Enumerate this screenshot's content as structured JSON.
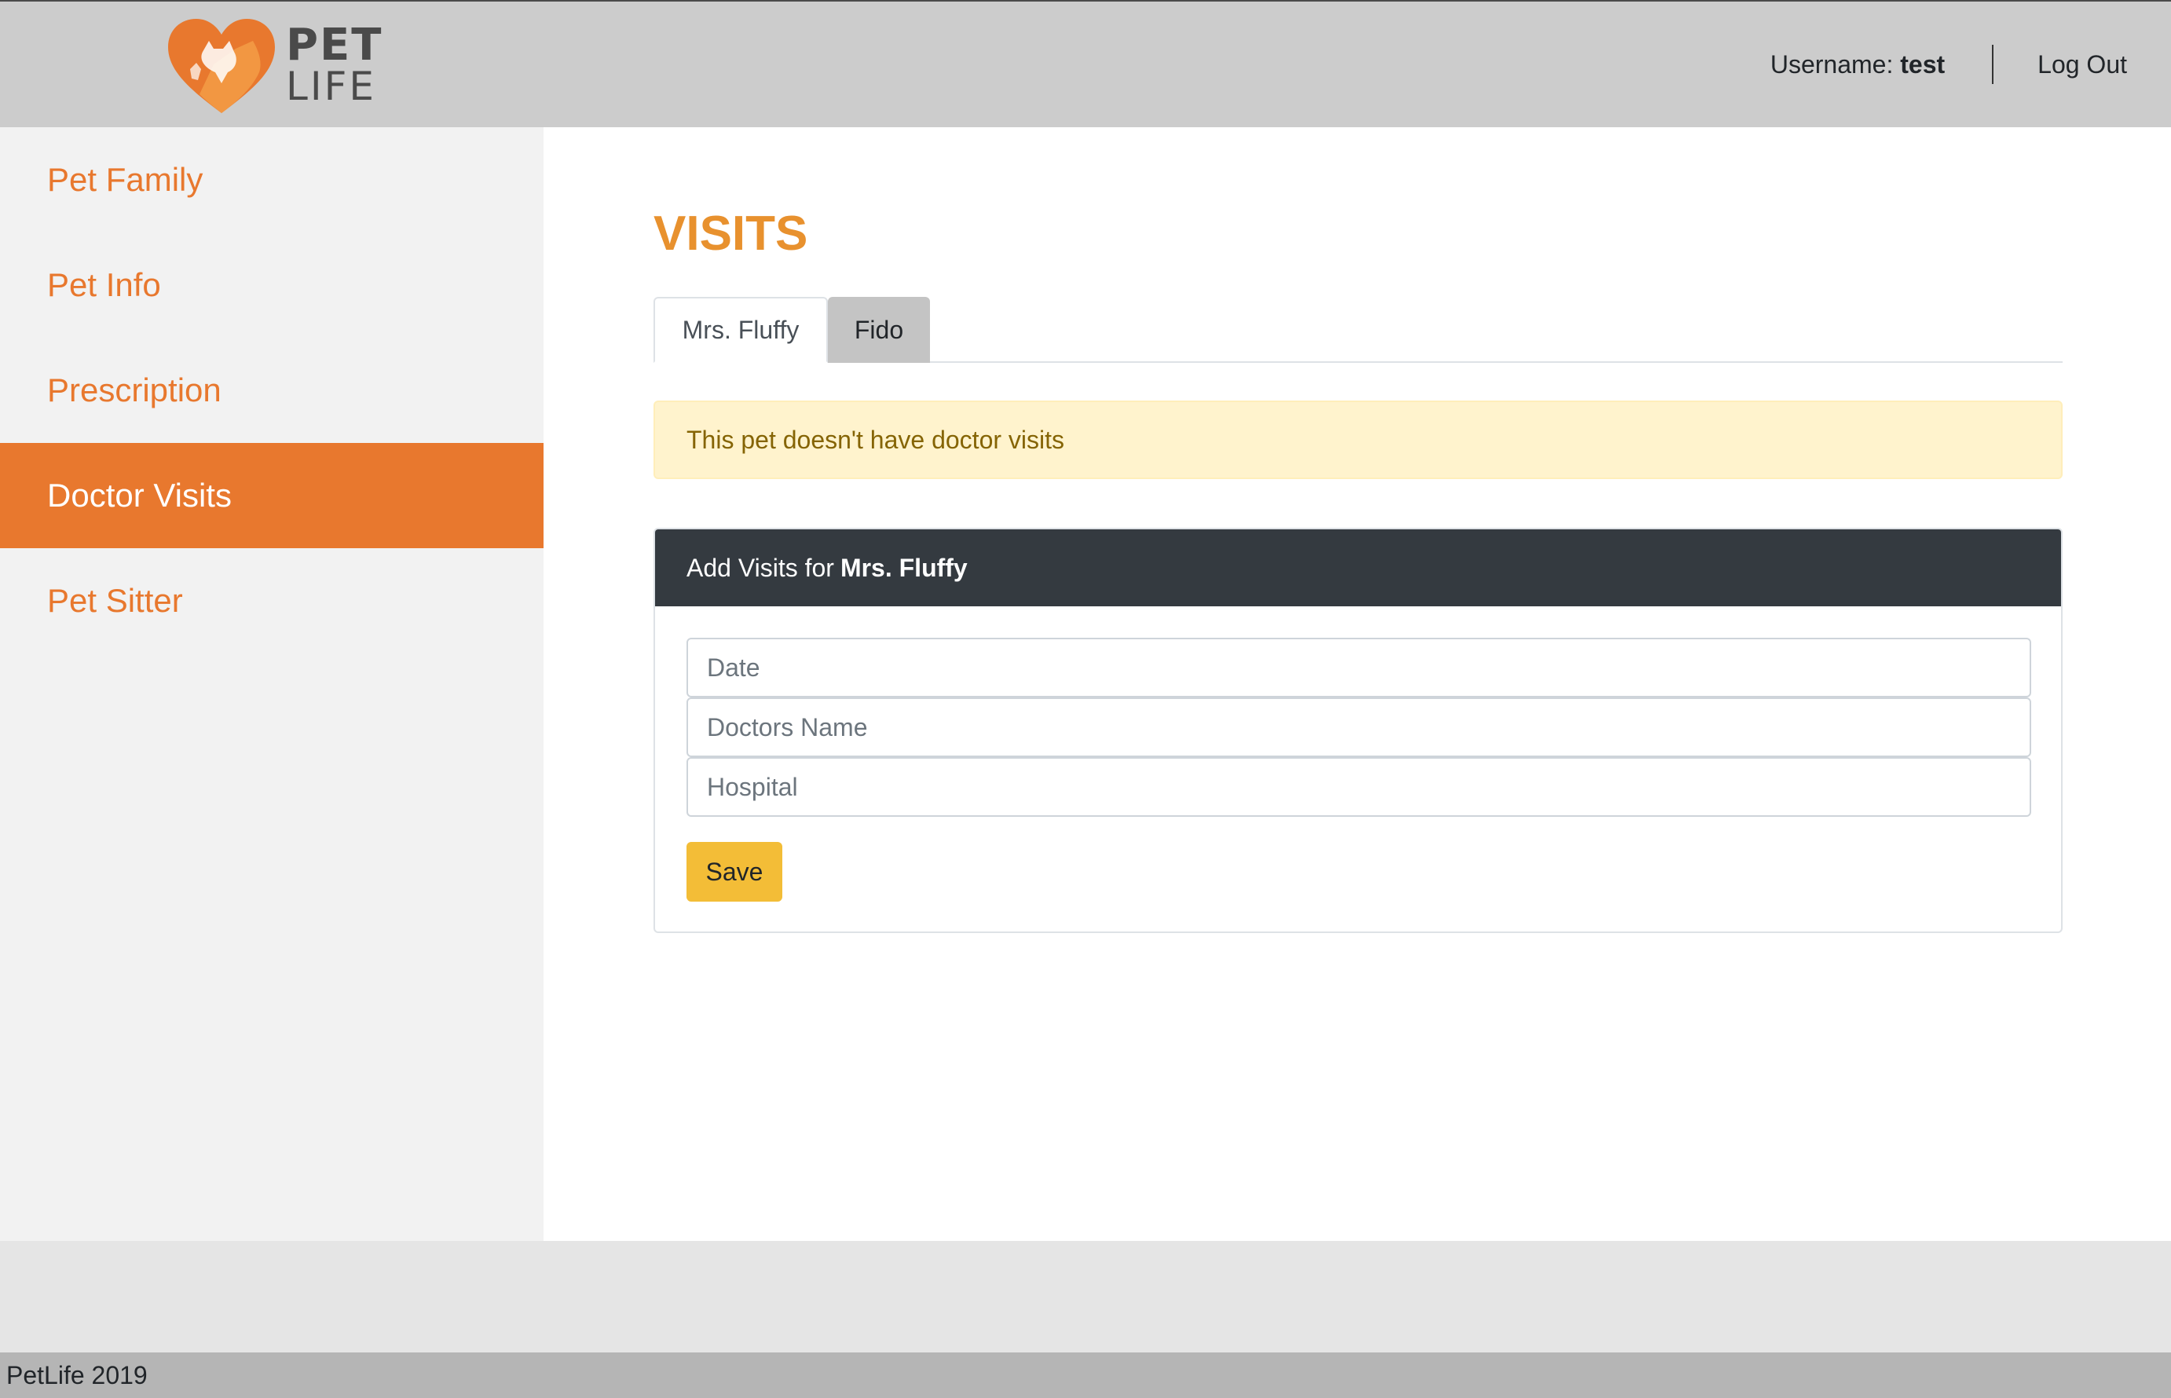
{
  "header": {
    "logo": {
      "line1": "PET",
      "line2": "LIFE"
    },
    "username_label": "Username:",
    "username_value": "test",
    "logout_label": "Log Out"
  },
  "sidebar": {
    "items": [
      {
        "label": "Pet Family",
        "active": false
      },
      {
        "label": "Pet Info",
        "active": false
      },
      {
        "label": "Prescription",
        "active": false
      },
      {
        "label": "Doctor Visits",
        "active": true
      },
      {
        "label": "Pet Sitter",
        "active": false
      }
    ]
  },
  "main": {
    "title": "VISITS",
    "tabs": [
      {
        "label": "Mrs. Fluffy",
        "active": true
      },
      {
        "label": "Fido",
        "active": false
      }
    ],
    "alert_text": "This pet doesn't have doctor visits",
    "form": {
      "header_prefix": "Add Visits for",
      "pet_name": "Mrs. Fluffy",
      "date_placeholder": "Date",
      "doctor_placeholder": "Doctors Name",
      "hospital_placeholder": "Hospital",
      "save_label": "Save"
    }
  },
  "footer": {
    "text": "PetLife 2019"
  },
  "colors": {
    "accent": "#e8782e",
    "title": "#e8912e",
    "alert_bg": "#fff3cd",
    "card_header": "#343a40",
    "save_button": "#f3bd37"
  }
}
